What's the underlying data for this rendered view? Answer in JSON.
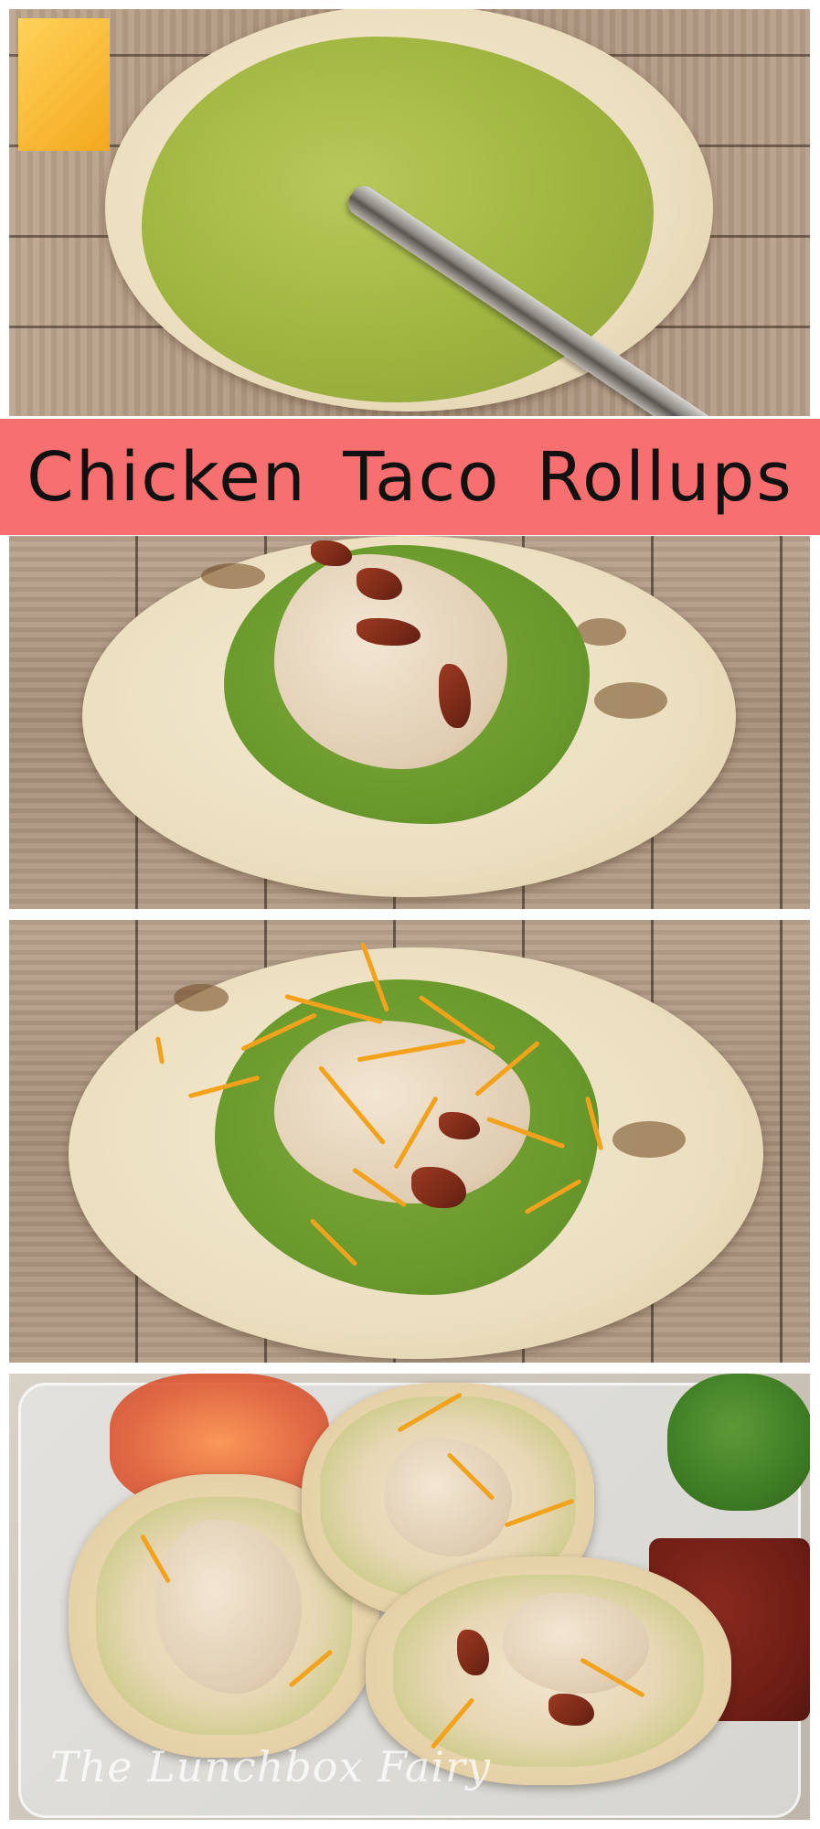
{
  "title": "Chicken Taco Rollups",
  "watermark": "The Lunchbox Fairy"
}
